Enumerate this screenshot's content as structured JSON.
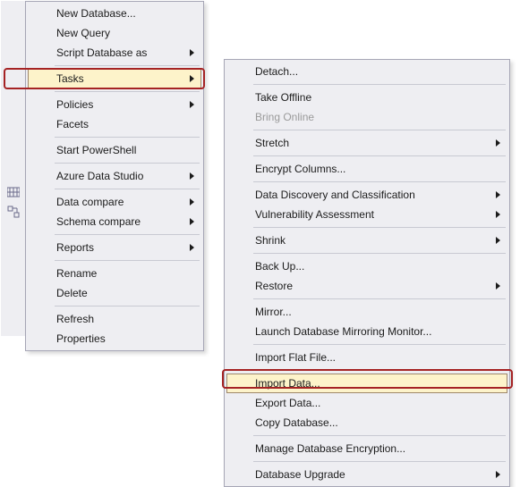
{
  "menu1": {
    "new_database": "New Database...",
    "new_query": "New Query",
    "script_database_as": "Script Database as",
    "tasks": "Tasks",
    "policies": "Policies",
    "facets": "Facets",
    "start_powershell": "Start PowerShell",
    "azure_data_studio": "Azure Data Studio",
    "data_compare": "Data compare",
    "schema_compare": "Schema compare",
    "reports": "Reports",
    "rename": "Rename",
    "delete": "Delete",
    "refresh": "Refresh",
    "properties": "Properties"
  },
  "menu2": {
    "detach": "Detach...",
    "take_offline": "Take Offline",
    "bring_online": "Bring Online",
    "stretch": "Stretch",
    "encrypt_columns": "Encrypt Columns...",
    "data_discovery": "Data Discovery and Classification",
    "vulnerability_assessment": "Vulnerability Assessment",
    "shrink": "Shrink",
    "back_up": "Back Up...",
    "restore": "Restore",
    "mirror": "Mirror...",
    "launch_mirroring_monitor": "Launch Database Mirroring Monitor...",
    "import_flat_file": "Import Flat File...",
    "import_data": "Import Data...",
    "export_data": "Export Data...",
    "copy_database": "Copy Database...",
    "manage_encryption": "Manage Database Encryption...",
    "database_upgrade": "Database Upgrade"
  },
  "left_icons": {
    "data_compare": "data-compare-icon",
    "schema_compare": "schema-compare-icon"
  }
}
